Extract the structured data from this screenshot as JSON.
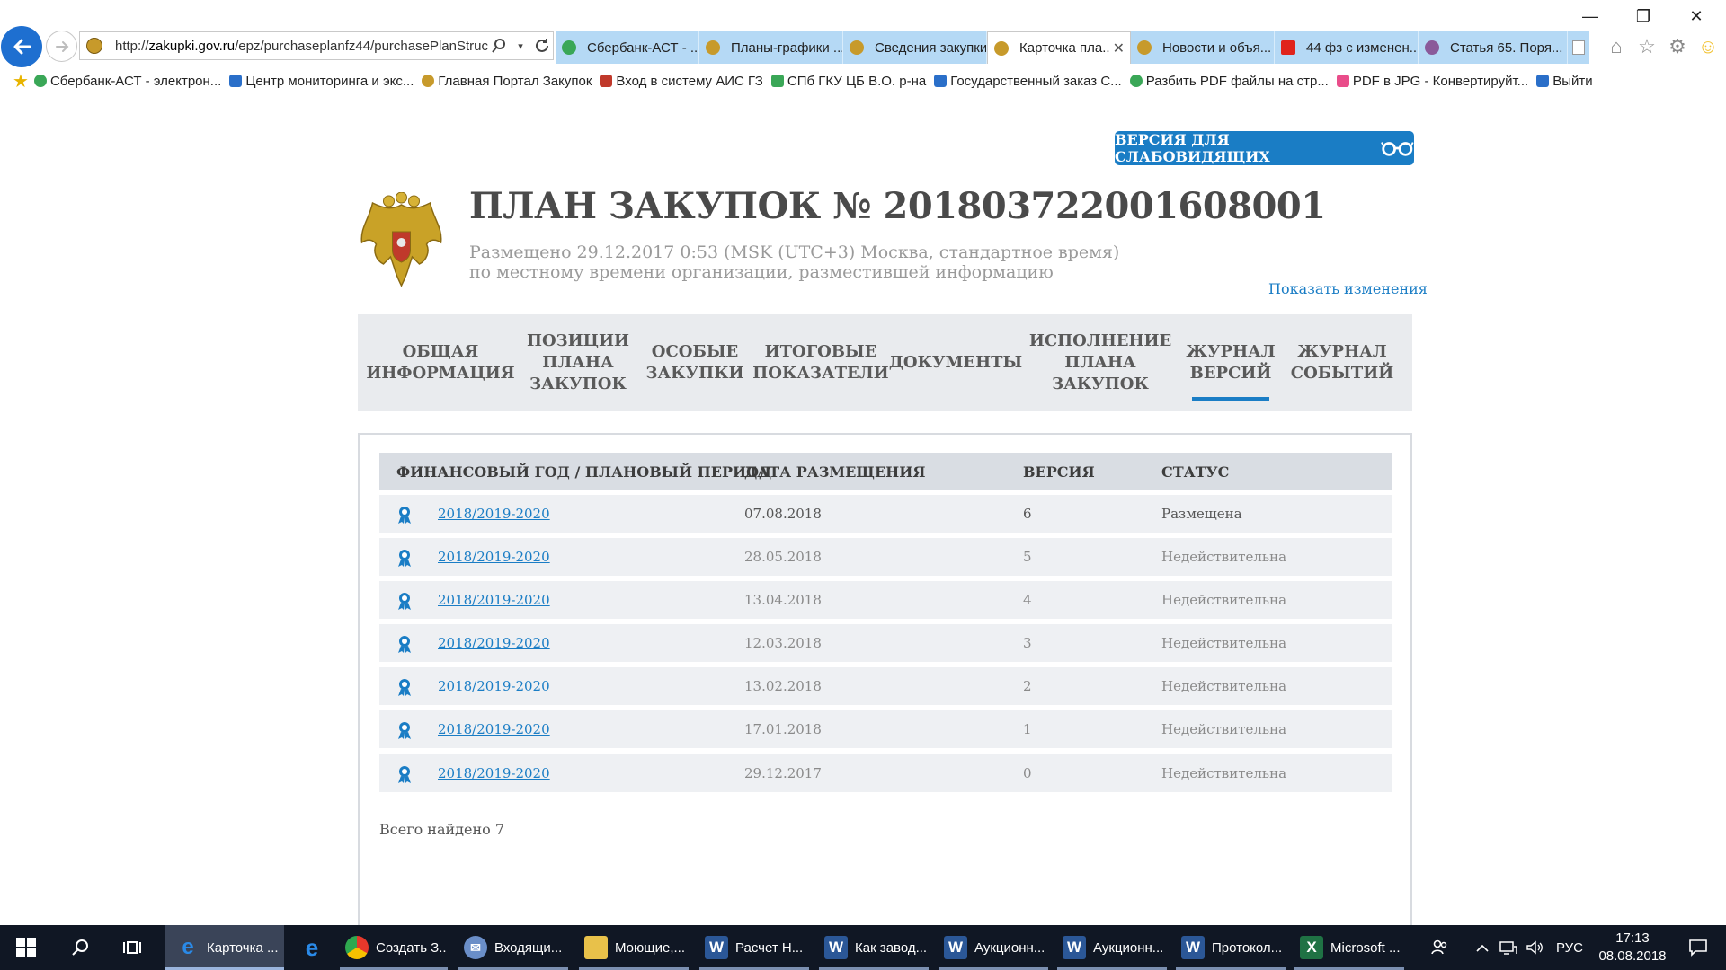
{
  "browser": {
    "address_prefix": "http://",
    "address_domain": "zakupki.gov.ru",
    "address_path": "/epz/purchaseplanfz44/purchasePlanStruc",
    "tabs": [
      {
        "label": "Сбербанк-АСТ - ...",
        "color": "#3aa757"
      },
      {
        "label": "Планы-графики ...",
        "color": "#c79a2b"
      },
      {
        "label": "Сведения закупки",
        "color": "#c79a2b"
      },
      {
        "label": "Карточка пла...",
        "color": "#c79a2b",
        "active": true
      },
      {
        "label": "Новости и объя...",
        "color": "#c79a2b"
      },
      {
        "label": "44 фз с изменен...",
        "color": "#e0231b"
      },
      {
        "label": "Статья 65. Поря...",
        "color": "#8a5a9a"
      }
    ],
    "favorites": [
      {
        "label": "Сбербанк-АСТ - электрон...",
        "color": "#3aa757"
      },
      {
        "label": "Центр мониторинга и экс...",
        "color": "#2a6fc9"
      },
      {
        "label": "Главная Портал Закупок",
        "color": "#c79a2b"
      },
      {
        "label": "Вход в систему  АИС ГЗ",
        "color": "#c0392b"
      },
      {
        "label": "СПб ГКУ ЦБ В.О. р-на",
        "color": "#3aa757"
      },
      {
        "label": "Государственный заказ С...",
        "color": "#2a6fc9"
      },
      {
        "label": "Разбить PDF файлы на стр...",
        "color": "#3aa757"
      },
      {
        "label": "PDF в JPG - Конвертируйт...",
        "color": "#e94d8a"
      },
      {
        "label": "Выйти",
        "color": "#2a6fc9"
      }
    ]
  },
  "page": {
    "vision_button": "ВЕРСИЯ ДЛЯ СЛАБОВИДЯЩИХ",
    "title": "ПЛАН ЗАКУПОК № 201803722001608001",
    "posted_line": "Размещено 29.12.2017 0:53 (MSK (UTC+3) Москва, стандартное время)",
    "posted_line2": "по местному времени организации, разместившей информацию",
    "changes_link": "Показать изменения",
    "nav_tabs": [
      "ОБЩАЯ\nИНФОРМАЦИЯ",
      "ПОЗИЦИИ\nПЛАНА\nЗАКУПОК",
      "ОСОБЫЕ\nЗАКУПКИ",
      "ИТОГОВЫЕ\nПОКАЗАТЕЛИ",
      "ДОКУМЕНТЫ",
      "ИСПОЛНЕНИЕ\nПЛАНА\nЗАКУПОК",
      "ЖУРНАЛ\nВЕРСИЙ",
      "ЖУРНАЛ\nСОБЫТИЙ"
    ],
    "active_tab": "ЖУРНАЛ ВЕРСИЙ",
    "table": {
      "headers": [
        "ФИНАНСОВЫЙ ГОД / ПЛАНОВЫЙ ПЕРИОД",
        "ДАТА РАЗМЕЩЕНИЯ",
        "ВЕРСИЯ",
        "СТАТУС"
      ],
      "rows": [
        {
          "period": "2018/2019-2020",
          "date": "07.08.2018",
          "version": "6",
          "status": "Размещена"
        },
        {
          "period": "2018/2019-2020",
          "date": "28.05.2018",
          "version": "5",
          "status": "Недействительна"
        },
        {
          "period": "2018/2019-2020",
          "date": "13.04.2018",
          "version": "4",
          "status": "Недействительна"
        },
        {
          "period": "2018/2019-2020",
          "date": "12.03.2018",
          "version": "3",
          "status": "Недействительна"
        },
        {
          "period": "2018/2019-2020",
          "date": "13.02.2018",
          "version": "2",
          "status": "Недействительна"
        },
        {
          "period": "2018/2019-2020",
          "date": "17.01.2018",
          "version": "1",
          "status": "Недействительна"
        },
        {
          "period": "2018/2019-2020",
          "date": "29.12.2017",
          "version": "0",
          "status": "Недействительна"
        }
      ]
    },
    "found_text": "Всего найдено 7"
  },
  "taskbar": {
    "items": [
      {
        "label": "Карточка ...",
        "icon": "ie-icon",
        "color": "#2a8ae8",
        "glyph": "e"
      },
      {
        "label": "",
        "icon": "edge-icon",
        "color": "#2a8ae8",
        "glyph": "e"
      },
      {
        "label": "Создать З...",
        "icon": "chrome-icon",
        "color": "#e5382b",
        "glyph": "●"
      },
      {
        "label": "Входящи...",
        "icon": "thunderbird-icon",
        "color": "#6a8ec8",
        "glyph": "✉"
      },
      {
        "label": "Моющие,...",
        "icon": "folder-icon",
        "color": "#e8c14a",
        "glyph": "▮"
      },
      {
        "label": "Расчет Н...",
        "icon": "word-icon",
        "color": "#2b5797",
        "glyph": "W"
      },
      {
        "label": "Как завод...",
        "icon": "word-icon",
        "color": "#2b5797",
        "glyph": "W"
      },
      {
        "label": "Аукционн...",
        "icon": "word-icon",
        "color": "#2b5797",
        "glyph": "W"
      },
      {
        "label": "Аукционн...",
        "icon": "word-icon",
        "color": "#2b5797",
        "glyph": "W"
      },
      {
        "label": "Протокол...",
        "icon": "word-icon",
        "color": "#2b5797",
        "glyph": "W"
      },
      {
        "label": "Microsoft ...",
        "icon": "excel-icon",
        "color": "#1f7244",
        "glyph": "X"
      }
    ],
    "lang": "РУС",
    "time": "17:13",
    "date": "08.08.2018"
  }
}
